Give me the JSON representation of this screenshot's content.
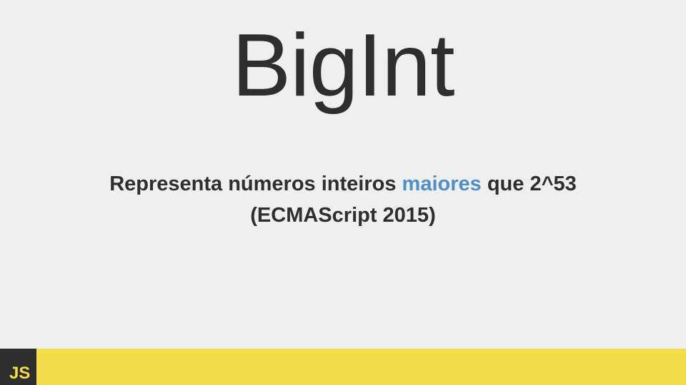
{
  "slide": {
    "title": "BigInt",
    "body": {
      "line1_prefix": "Representa números inteiros ",
      "line1_highlight": "maiores",
      "line1_suffix": " que 2^53",
      "line2": "(ECMAScript 2015)"
    },
    "footer": {
      "badge_text": "JS"
    }
  },
  "colors": {
    "background": "#efefef",
    "text": "#2e2e2e",
    "highlight": "#4f8fc6",
    "footer_bar": "#f3dd4c",
    "badge_bg": "#2e2e2e"
  }
}
